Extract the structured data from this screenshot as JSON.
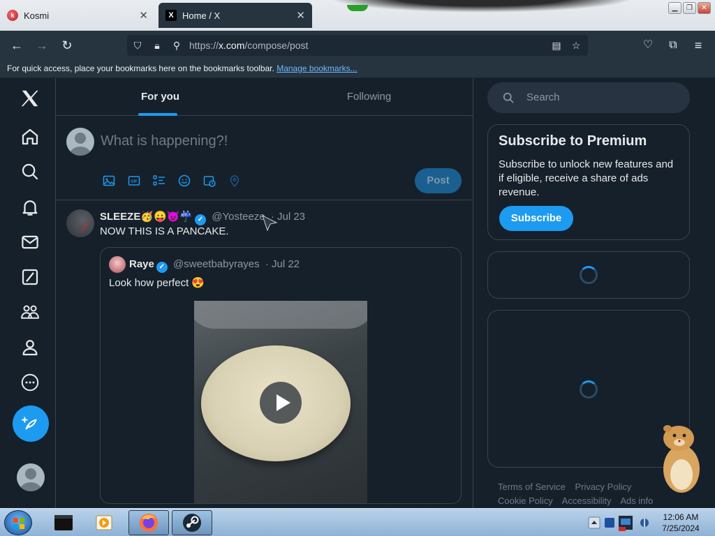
{
  "browser": {
    "tabs": [
      {
        "title": "Kosmi",
        "favicon": "kosmi-icon"
      },
      {
        "title": "Home / X",
        "favicon": "x-logo-icon"
      }
    ],
    "url_prefix": "https://",
    "url_domain": "x.com",
    "url_path": "/compose/post",
    "bookmarks_bar_text": "For quick access, place your bookmarks here on the bookmarks toolbar.",
    "bookmarks_link": "Manage bookmarks..."
  },
  "left_nav": [
    "x-logo-icon",
    "home-icon",
    "search-icon",
    "notifications-icon",
    "messages-icon",
    "grok-icon",
    "communities-icon",
    "profile-icon",
    "more-icon"
  ],
  "feed": {
    "tabs": [
      {
        "label": "For you",
        "active": true
      },
      {
        "label": "Following",
        "active": false
      }
    ],
    "composer": {
      "placeholder": "What is happening?!",
      "post_label": "Post"
    }
  },
  "tweet": {
    "name": "SLEEZE",
    "emojis": "🥳😛😈☔",
    "handle": "@Yosteeze",
    "date": "· Jul 23",
    "text": "NOW THIS IS A PANCAKE.",
    "quote": {
      "name": "Raye",
      "handle": "@sweetbabyrayes",
      "date": "· Jul 22",
      "text": "Look how perfect 😍"
    }
  },
  "sidebar": {
    "search_placeholder": "Search",
    "premium": {
      "title": "Subscribe to Premium",
      "body": "Subscribe to unlock new features and if eligible, receive a share of ads revenue.",
      "button": "Subscribe"
    },
    "footer": {
      "links": [
        "Terms of Service",
        "Privacy Policy",
        "Cookie Policy",
        "Accessibility",
        "Ads info"
      ]
    }
  },
  "taskbar": {
    "time": "12:06 AM",
    "date": "7/25/2024"
  },
  "colors": {
    "accent": "#1d9bf0",
    "background": "#15202b",
    "border": "#38444d"
  }
}
